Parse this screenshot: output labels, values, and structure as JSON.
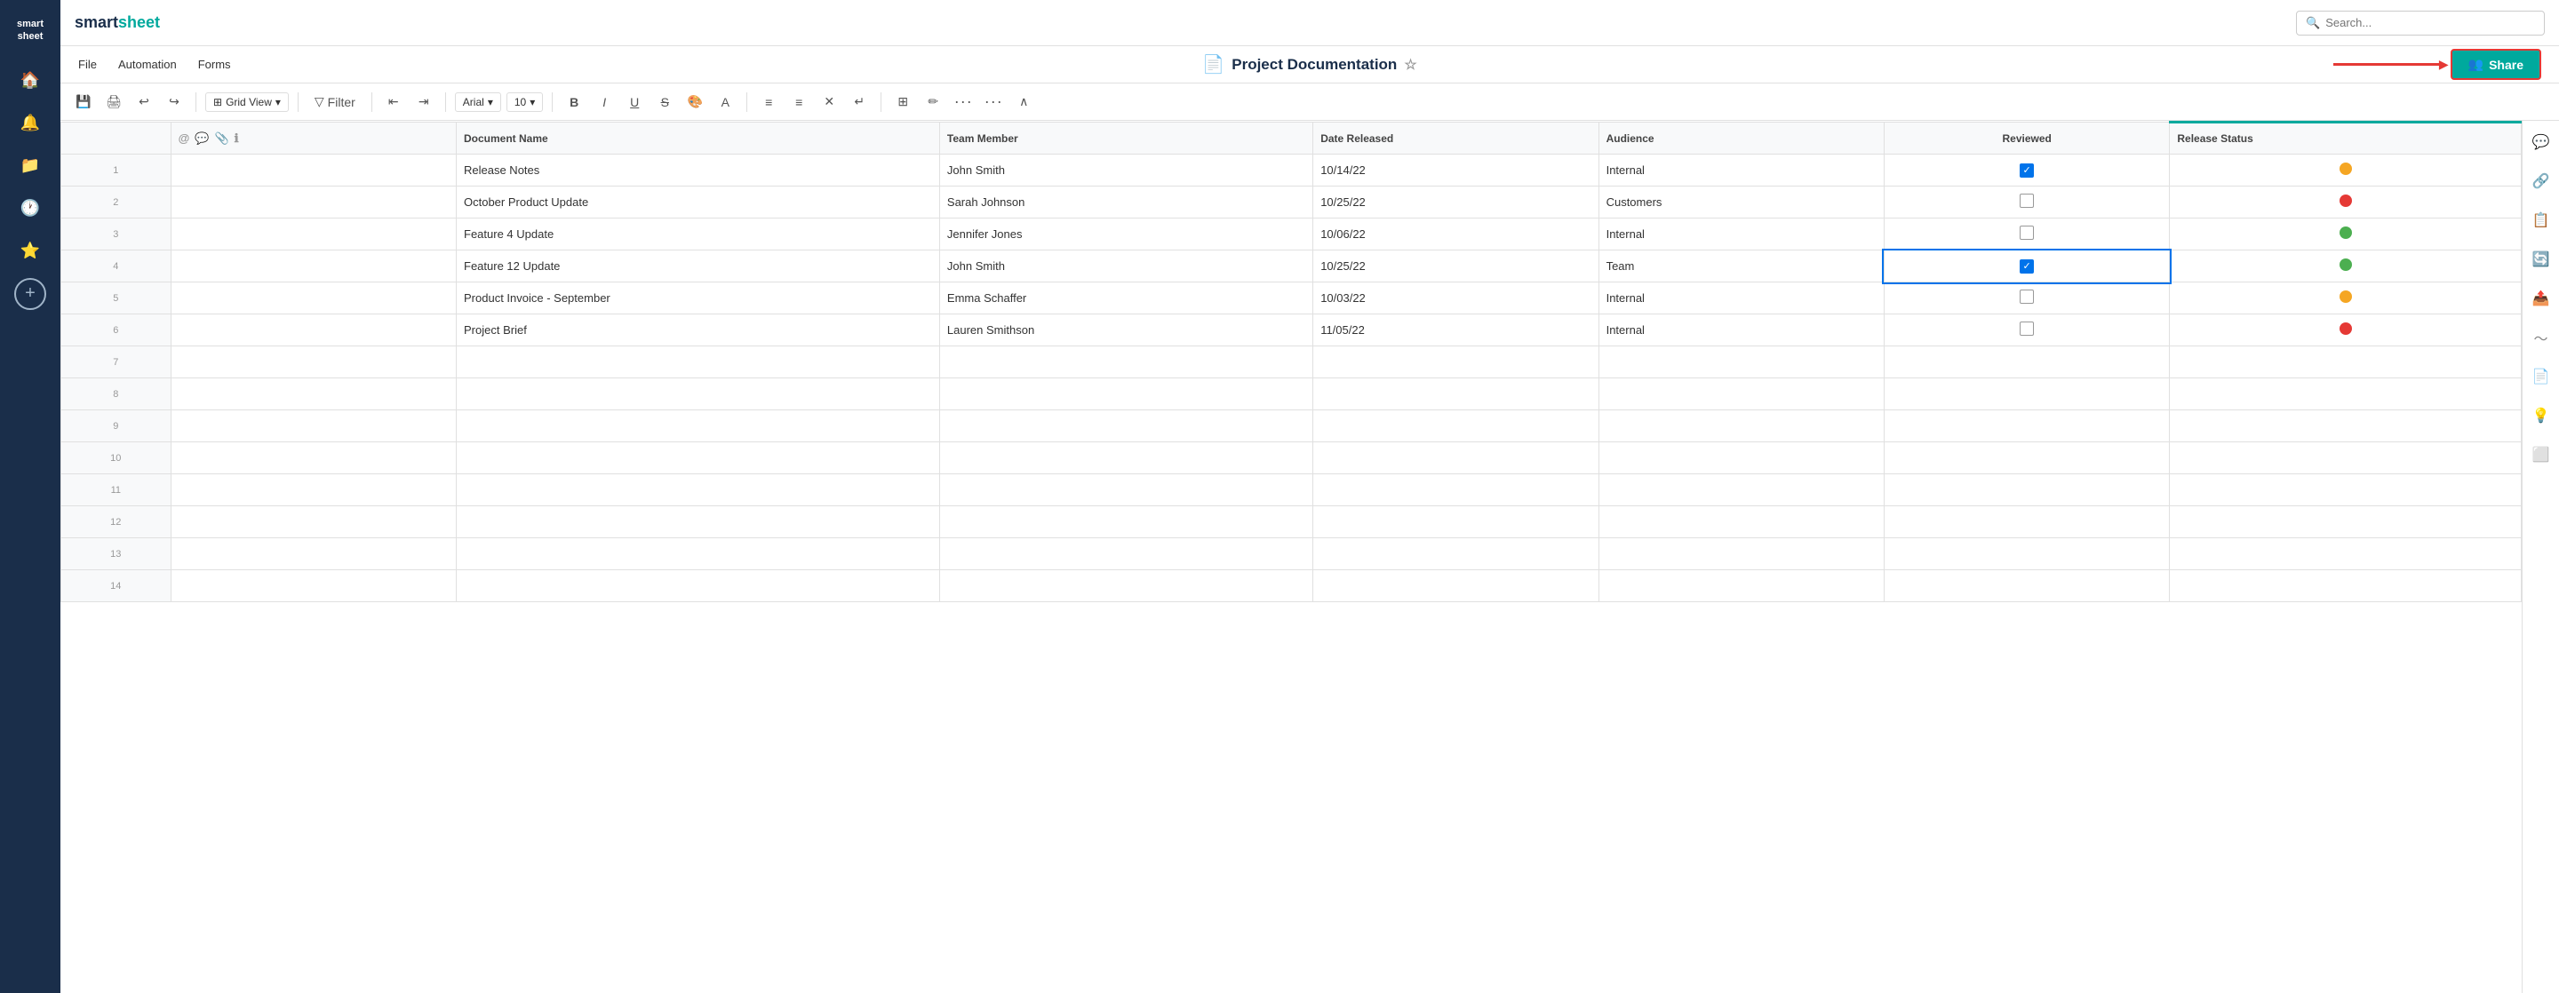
{
  "app": {
    "name": "smartsheet",
    "name_styled": "smart<span>sheet</span>"
  },
  "topbar": {
    "search_placeholder": "Search..."
  },
  "menubar": {
    "items": [
      "File",
      "Automation",
      "Forms"
    ],
    "doc_title": "Project Documentation",
    "share_label": "Share"
  },
  "toolbar": {
    "grid_view_label": "Grid View",
    "filter_label": "Filter",
    "font_label": "Arial",
    "font_size": "10"
  },
  "columns": {
    "icons_header": "",
    "doc_name": "Document Name",
    "team_member": "Team Member",
    "date_released": "Date Released",
    "audience": "Audience",
    "reviewed": "Reviewed",
    "release_status": "Release Status"
  },
  "rows": [
    {
      "num": "1",
      "doc_name": "Release Notes",
      "team_member": "John Smith",
      "date_released": "10/14/22",
      "audience": "Internal",
      "reviewed": true,
      "reviewed_focused": false,
      "status_color": "yellow"
    },
    {
      "num": "2",
      "doc_name": "October Product Update",
      "team_member": "Sarah Johnson",
      "date_released": "10/25/22",
      "audience": "Customers",
      "reviewed": false,
      "reviewed_focused": false,
      "status_color": "red"
    },
    {
      "num": "3",
      "doc_name": "Feature 4 Update",
      "team_member": "Jennifer Jones",
      "date_released": "10/06/22",
      "audience": "Internal",
      "reviewed": false,
      "reviewed_focused": false,
      "status_color": "green"
    },
    {
      "num": "4",
      "doc_name": "Feature 12 Update",
      "team_member": "John Smith",
      "date_released": "10/25/22",
      "audience": "Team",
      "reviewed": true,
      "reviewed_focused": true,
      "status_color": "green"
    },
    {
      "num": "5",
      "doc_name": "Product Invoice - September",
      "team_member": "Emma Schaffer",
      "date_released": "10/03/22",
      "audience": "Internal",
      "reviewed": false,
      "reviewed_focused": false,
      "status_color": "yellow"
    },
    {
      "num": "6",
      "doc_name": "Project Brief",
      "team_member": "Lauren Smithson",
      "date_released": "11/05/22",
      "audience": "Internal",
      "reviewed": false,
      "reviewed_focused": false,
      "status_color": "red"
    },
    {
      "num": "7"
    },
    {
      "num": "8"
    },
    {
      "num": "9"
    },
    {
      "num": "10"
    },
    {
      "num": "11"
    },
    {
      "num": "12"
    },
    {
      "num": "13"
    },
    {
      "num": "14"
    }
  ],
  "sidebar_icons": [
    "🏠",
    "🔔",
    "📁",
    "🕐",
    "⭐",
    "+"
  ],
  "right_panel_icons": [
    "💬",
    "🔗",
    "📋",
    "🔄",
    "📤",
    "〜",
    "📄",
    "💡",
    "⬜"
  ]
}
